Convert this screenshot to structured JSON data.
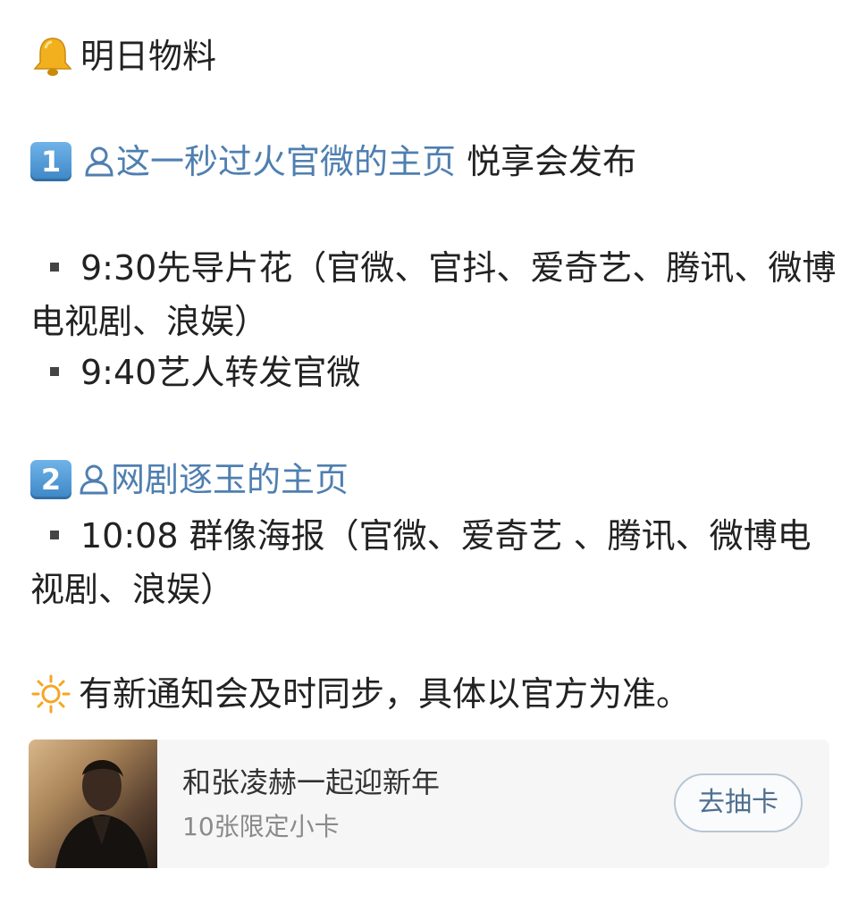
{
  "post": {
    "header": "明日物料",
    "item1": {
      "number": "1",
      "link": "这一秒过火官微的主页",
      "suffix": " 悦享会发布",
      "bullets": [
        "9:30先导片花（官微、官抖、爱奇艺、腾讯、微博电视剧、浪娱）",
        "9:40艺人转发官微"
      ]
    },
    "item2": {
      "number": "2",
      "link": "网剧逐玉的主页",
      "bullets": [
        "10:08  群像海报（官微、爱奇艺 、腾讯、微博电视剧、浪娱）"
      ]
    },
    "notice": "有新通知会及时同步，具体以官方为准。"
  },
  "card": {
    "title": "和张凌赫一起迎新年",
    "subtitle": "10张限定小卡",
    "button": "去抽卡"
  },
  "colors": {
    "link": "#4f7fb0",
    "keycap": "#4a90d0",
    "bell": "#f2b01e",
    "sun": "#f5a623"
  }
}
